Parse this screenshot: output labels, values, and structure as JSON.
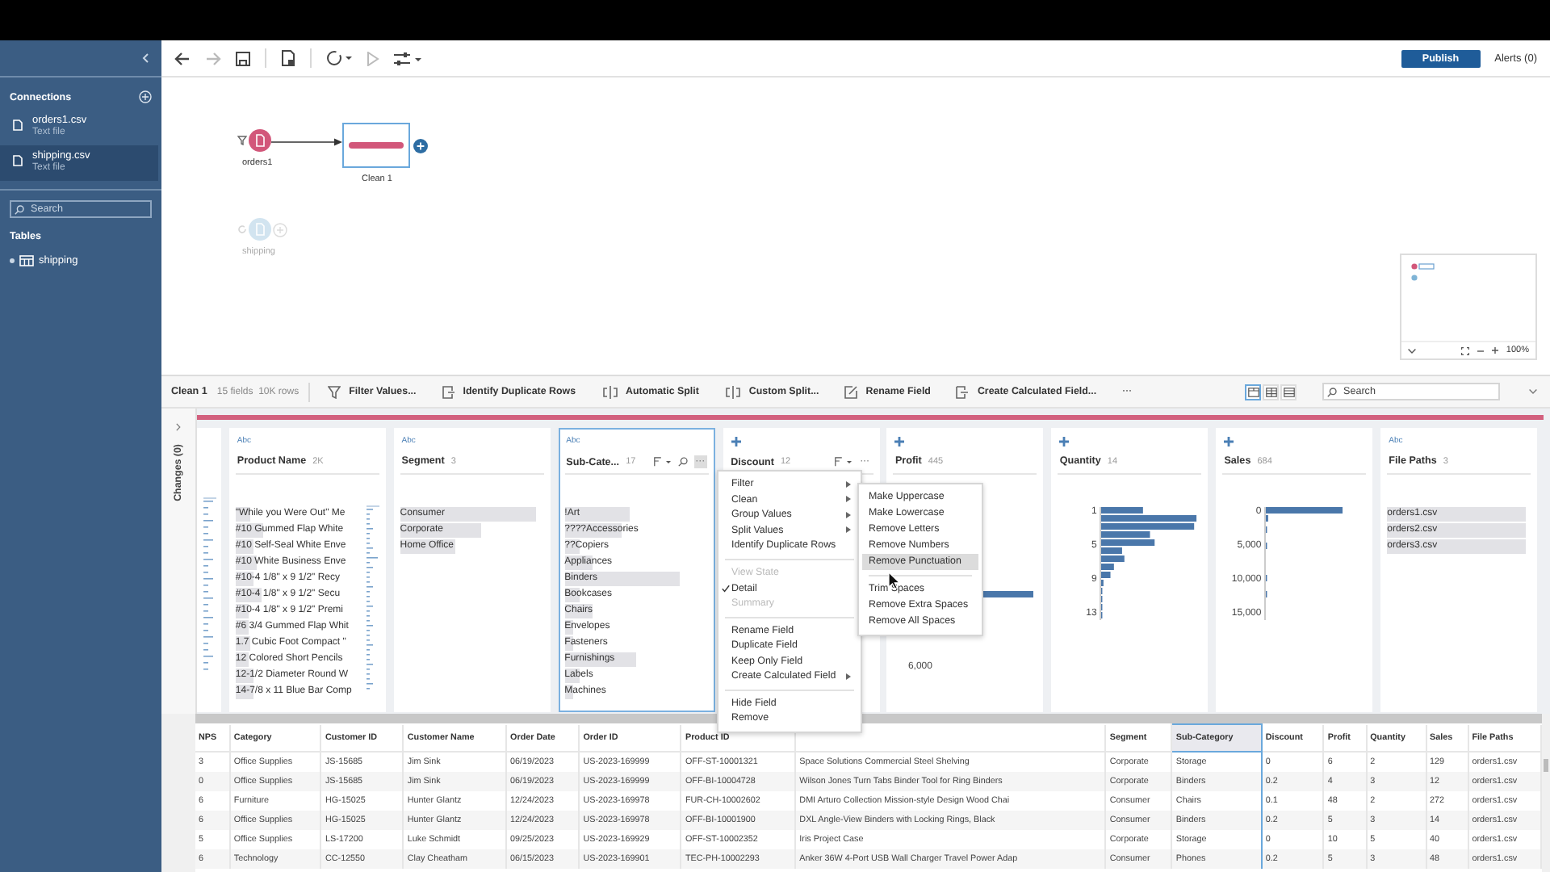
{
  "sidebar": {
    "connections_title": "Connections",
    "connections": [
      {
        "name": "orders1.csv",
        "type": "Text file",
        "selected": false
      },
      {
        "name": "shipping.csv",
        "type": "Text file",
        "selected": true
      }
    ],
    "search": {
      "placeholder": "Search"
    },
    "tables_title": "Tables",
    "tables": [
      {
        "name": "shipping"
      }
    ]
  },
  "toolbar": {
    "buttons": [
      {
        "kind": "back",
        "disabled": false
      },
      {
        "kind": "forward",
        "disabled": true
      },
      {
        "kind": "save",
        "disabled": false
      },
      {
        "kind": "data",
        "disabled": false
      },
      {
        "kind": "refresh",
        "disabled": false
      },
      {
        "kind": "run",
        "disabled": true
      },
      {
        "kind": "settings",
        "disabled": false
      }
    ],
    "publish": "Publish",
    "alerts": "Alerts (0)"
  },
  "flow": {
    "nodes": [
      {
        "kind": "input",
        "label": "orders1",
        "faded": false
      },
      {
        "kind": "clean",
        "label": "Clean 1",
        "selected": true
      },
      {
        "kind": "input",
        "label": "shipping",
        "faded": true
      }
    ],
    "minimap": {
      "zoom": "100%"
    }
  },
  "pane": {
    "title": "Clean 1",
    "summary": "15 fields  10K rows",
    "actions": [
      {
        "kind": "filter",
        "label": "Filter Values..."
      },
      {
        "kind": "duplicate",
        "label": "Identify Duplicate Rows"
      },
      {
        "kind": "split",
        "label": "Automatic Split"
      },
      {
        "kind": "split",
        "label": "Custom Split..."
      },
      {
        "kind": "rename",
        "label": "Rename Field"
      },
      {
        "kind": "calculate",
        "label": "Create Calculated Field..."
      }
    ],
    "more": "···",
    "views": [
      {
        "kind": "profile",
        "selected": true
      },
      {
        "kind": "grid",
        "selected": false
      },
      {
        "kind": "list",
        "selected": false
      }
    ],
    "search": {
      "placeholder": "Search"
    },
    "changes": "Changes (0)"
  },
  "cards": [
    {
      "kind": "string",
      "type_label": "Abc",
      "name": "Product Name",
      "count": "2K",
      "selected": false,
      "values": [
        {
          "label": "\"While you Were Out\" Me",
          "level": 0.12
        },
        {
          "label": "#10 Gummed Flap White",
          "level": 0.22
        },
        {
          "label": "#10 Self-Seal White Enve",
          "level": 0.14
        },
        {
          "label": "#10 White Business Enve",
          "level": 0.16
        },
        {
          "label": "#10-4 1/8\" x 9 1/2\" Recy",
          "level": 0.14
        },
        {
          "label": "#10-4 1/8\" x 9 1/2\" Secu",
          "level": 0.2
        },
        {
          "label": "#10-4 1/8\" x 9 1/2\" Premi",
          "level": 0.1
        },
        {
          "label": "#6 3/4 Gummed Flap Whit",
          "level": 0.1
        },
        {
          "label": "1.7 Cubic Foot Compact \"",
          "level": 0.12
        },
        {
          "label": "12 Colored Short Pencils",
          "level": 0.1
        },
        {
          "label": "12-1/2 Diameter Round W",
          "level": 0.14
        },
        {
          "label": "14-7/8 x 11 Blue Bar Comp",
          "level": 0.14
        }
      ]
    },
    {
      "kind": "string",
      "type_label": "Abc",
      "name": "Segment",
      "count": "3",
      "selected": false,
      "values": [
        {
          "label": "Consumer",
          "level": 0.95
        },
        {
          "label": "Corporate",
          "level": 0.56
        },
        {
          "label": "Home Office",
          "level": 0.38
        }
      ]
    },
    {
      "kind": "string",
      "type_label": "Abc",
      "name": "Sub-Cate...",
      "count": "17",
      "selected": true,
      "tools": [
        {
          "kind": "sort"
        },
        {
          "kind": "search"
        }
      ],
      "more": "···",
      "more_active": true,
      "values": [
        {
          "label": "!Art",
          "level": 0.45
        },
        {
          "label": "????Accessories",
          "level": 0.4
        },
        {
          "label": "??Copiers",
          "level": 0.1
        },
        {
          "label": "Appliances",
          "level": 0.2
        },
        {
          "label": "Binders",
          "level": 0.8
        },
        {
          "label": "Bookcases",
          "level": 0.1
        },
        {
          "label": "Chairs",
          "level": 0.2
        },
        {
          "label": "Envelopes",
          "level": 0.06
        },
        {
          "label": "Fasteners",
          "level": 0.06
        },
        {
          "label": "Furnishings",
          "level": 0.5
        },
        {
          "label": "Labels",
          "level": 0.1
        },
        {
          "label": "Machines",
          "level": 0.06
        }
      ]
    },
    {
      "kind": "number",
      "name": "Discount",
      "count": "12",
      "selected": false,
      "tools": [
        {
          "kind": "sort"
        }
      ],
      "more": "···",
      "more_active": false
    },
    {
      "kind": "number",
      "name": "Profit",
      "count": "445",
      "selected": false,
      "axis_labels": [
        "6,000"
      ]
    },
    {
      "kind": "number",
      "name": "Quantity",
      "count": "14",
      "selected": false,
      "axis_labels": [
        "1",
        "5",
        "9",
        "13"
      ]
    },
    {
      "kind": "number",
      "name": "Sales",
      "count": "684",
      "selected": false,
      "axis_labels": [
        "0",
        "5,000",
        "10,000",
        "15,000"
      ]
    },
    {
      "kind": "string",
      "type_label": "Abc",
      "name": "File Paths",
      "count": "3",
      "selected": false,
      "values": [
        {
          "label": "orders1.csv",
          "level": 0.97
        },
        {
          "label": "orders2.csv",
          "level": 0.97
        },
        {
          "label": "orders3.csv",
          "level": 0.97
        }
      ]
    }
  ],
  "menu": {
    "items": [
      {
        "kind": "item",
        "label": "Filter",
        "submenu": true
      },
      {
        "kind": "item",
        "label": "Clean",
        "submenu": true
      },
      {
        "kind": "item",
        "label": "Group Values",
        "submenu": true
      },
      {
        "kind": "item",
        "label": "Split Values",
        "submenu": true
      },
      {
        "kind": "item",
        "label": "Identify Duplicate Rows",
        "submenu": false
      },
      {
        "kind": "separator"
      },
      {
        "kind": "header",
        "label": "View State"
      },
      {
        "kind": "item",
        "label": "Detail",
        "checked": true,
        "disabled": false
      },
      {
        "kind": "item",
        "label": "Summary",
        "checked": false,
        "disabled": true
      },
      {
        "kind": "separator"
      },
      {
        "kind": "item",
        "label": "Rename Field",
        "submenu": false
      },
      {
        "kind": "item",
        "label": "Duplicate Field",
        "submenu": false
      },
      {
        "kind": "item",
        "label": "Keep Only Field",
        "submenu": false
      },
      {
        "kind": "item",
        "label": "Create Calculated Field",
        "submenu": true
      },
      {
        "kind": "separator"
      },
      {
        "kind": "item",
        "label": "Hide Field",
        "submenu": false
      },
      {
        "kind": "item",
        "label": "Remove",
        "submenu": false
      }
    ]
  },
  "submenu": {
    "items": [
      {
        "kind": "item",
        "label": "Make Uppercase",
        "selected": false
      },
      {
        "kind": "item",
        "label": "Make Lowercase",
        "selected": false
      },
      {
        "kind": "item",
        "label": "Remove Letters",
        "selected": false
      },
      {
        "kind": "item",
        "label": "Remove Numbers",
        "selected": false
      },
      {
        "kind": "item",
        "label": "Remove Punctuation",
        "selected": true
      },
      {
        "kind": "separator"
      },
      {
        "kind": "item",
        "label": "Trim Spaces",
        "selected": false
      },
      {
        "kind": "item",
        "label": "Remove Extra Spaces",
        "selected": false
      },
      {
        "kind": "item",
        "label": "Remove All Spaces",
        "selected": false
      }
    ]
  },
  "grid": {
    "columns": [
      {
        "label": "NPS",
        "selected": false
      },
      {
        "label": "Category",
        "selected": false
      },
      {
        "label": "Customer ID",
        "selected": false
      },
      {
        "label": "Customer Name",
        "selected": false
      },
      {
        "label": "Order Date",
        "selected": false
      },
      {
        "label": "Order ID",
        "selected": false
      },
      {
        "label": "Product ID",
        "selected": false
      },
      {
        "selected": false
      },
      {
        "label": "Segment",
        "selected": false
      },
      {
        "label": "Sub-Category",
        "selected": true
      },
      {
        "label": "Discount",
        "selected": false
      },
      {
        "label": "Profit",
        "selected": false
      },
      {
        "label": "Quantity",
        "selected": false
      },
      {
        "label": "Sales",
        "selected": false
      },
      {
        "label": "File Paths",
        "selected": false
      }
    ],
    "rows": [
      [
        "3",
        "Office Supplies",
        "JS-15685",
        "Jim Sink",
        "06/19/2023",
        "US-2023-169999",
        "OFF-ST-10001321",
        "Space Solutions Commercial Steel Shelving",
        "Corporate",
        "Storage",
        "0",
        "6",
        "2",
        "129",
        "orders1.csv"
      ],
      [
        "0",
        "Office Supplies",
        "JS-15685",
        "Jim Sink",
        "06/19/2023",
        "US-2023-169999",
        "OFF-BI-10004728",
        "Wilson Jones Turn Tabs Binder Tool for Ring Binders",
        "Corporate",
        "Binders",
        "0.2",
        "4",
        "3",
        "12",
        "orders1.csv"
      ],
      [
        "6",
        "Furniture",
        "HG-15025",
        "Hunter Glantz",
        "12/24/2023",
        "US-2023-169978",
        "FUR-CH-10002602",
        "DMI Arturo Collection Mission-style Design Wood Chai",
        "Consumer",
        "Chairs",
        "0.1",
        "48",
        "2",
        "272",
        "orders1.csv"
      ],
      [
        "6",
        "Office Supplies",
        "HG-15025",
        "Hunter Glantz",
        "12/24/2023",
        "US-2023-169978",
        "OFF-BI-10001900",
        "DXL Angle-View Binders with Locking Rings, Black",
        "Consumer",
        "Binders",
        "0.2",
        "5",
        "3",
        "14",
        "orders1.csv"
      ],
      [
        "5",
        "Office Supplies",
        "LS-17200",
        "Luke Schmidt",
        "09/25/2023",
        "US-2023-169929",
        "OFF-ST-10002352",
        "Iris Project Case",
        "Corporate",
        "Storage",
        "0",
        "10",
        "5",
        "40",
        "orders1.csv"
      ],
      [
        "6",
        "Technology",
        "CC-12550",
        "Clay Cheatham",
        "06/15/2023",
        "US-2023-169901",
        "TEC-PH-10002293",
        "Anker 36W 4-Port USB Wall Charger Travel Power Adap",
        "Consumer",
        "Phones",
        "0.2",
        "5",
        "3",
        "48",
        "orders1.csv"
      ]
    ]
  }
}
